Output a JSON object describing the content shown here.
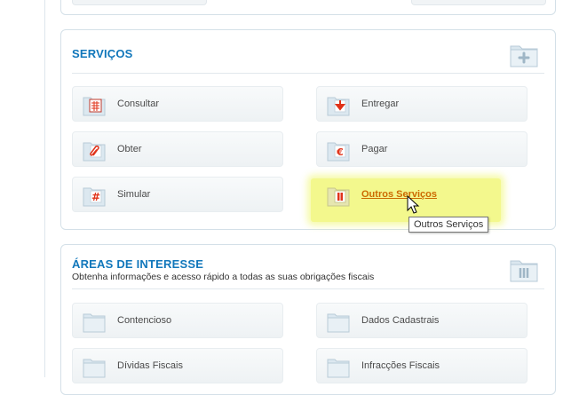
{
  "services": {
    "title": "SERVIÇOS",
    "buttons": [
      {
        "label": "Consultar",
        "icon": "calendar-icon"
      },
      {
        "label": "Entregar",
        "icon": "arrow-down-icon"
      },
      {
        "label": "Obter",
        "icon": "paperclip-icon"
      },
      {
        "label": "Pagar",
        "icon": "euro-icon"
      },
      {
        "label": "Simular",
        "icon": "hash-icon"
      },
      {
        "label": "Outros Serviços",
        "icon": "document-icon"
      }
    ],
    "tooltip": "Outros Serviços"
  },
  "areas": {
    "title": "ÁREAS DE INTERESSE",
    "subtitle": "Obtenha informações e acesso rápido a todas as suas obrigações fiscais",
    "buttons": [
      {
        "label": "Contencioso",
        "icon": "folder-icon"
      },
      {
        "label": "Dados Cadastrais",
        "icon": "folder-icon"
      },
      {
        "label": "Dívidas Fiscais",
        "icon": "folder-icon"
      },
      {
        "label": "Infracções Fiscais",
        "icon": "folder-icon"
      }
    ]
  },
  "colors": {
    "title_blue": "#1177bb",
    "accent_red": "#e0331a",
    "link_orange": "#cc6a00",
    "highlight_yellow": "#f2f77a"
  }
}
